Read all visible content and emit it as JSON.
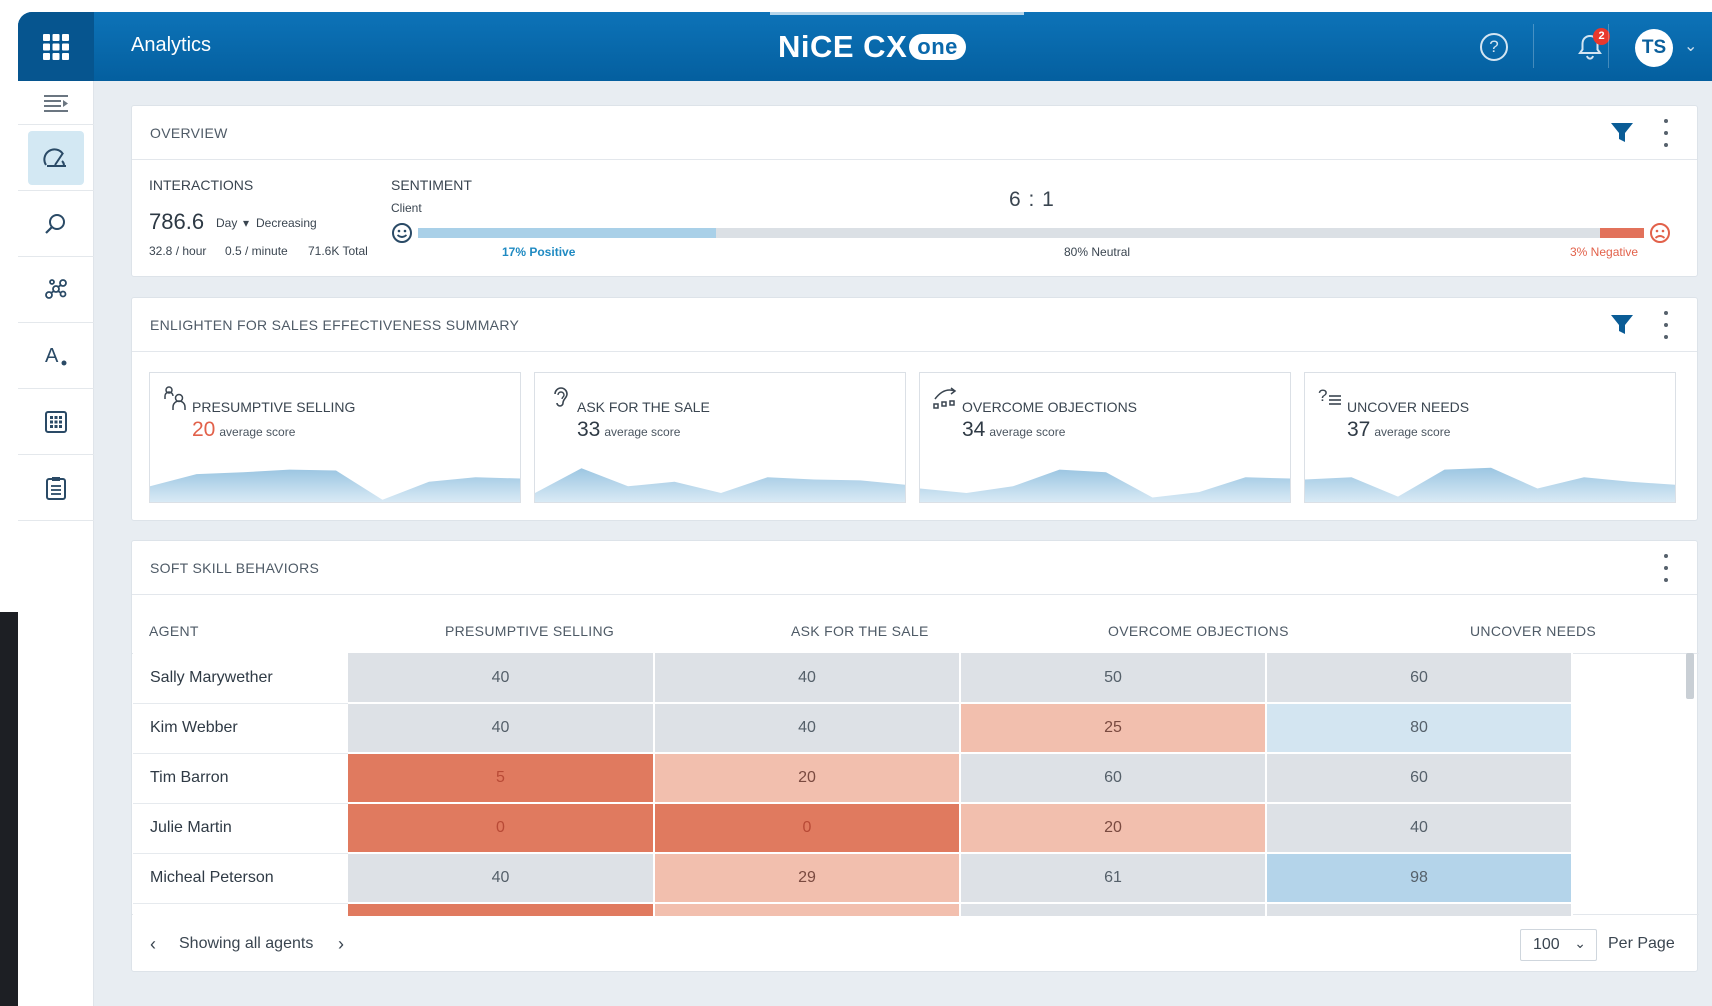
{
  "header": {
    "app_title": "Analytics",
    "brand_text": "NiCE CX",
    "brand_pill": "one",
    "notifications_count": "2",
    "avatar_initials": "TS",
    "accent_color": "#0a68ab"
  },
  "sidebar": {
    "items": [
      {
        "icon": "collapse-menu-icon"
      },
      {
        "icon": "dashboard-gauge-icon",
        "active": true
      },
      {
        "icon": "search-icon"
      },
      {
        "icon": "network-nodes-icon"
      },
      {
        "icon": "text-settings-icon"
      },
      {
        "icon": "calculator-grid-icon"
      },
      {
        "icon": "clipboard-list-icon"
      }
    ]
  },
  "overview": {
    "title": "OVERVIEW",
    "interactions_label": "INTERACTIONS",
    "interactions_value": "786.6",
    "period": "Day",
    "trend": "Decreasing",
    "per_hour": "32.8 / hour",
    "per_minute": "0.5 / minute",
    "total": "71.6K Total",
    "sentiment_label": "SENTIMENT",
    "sentiment_sub": "Client",
    "ratio": "6 : 1",
    "positive_label": "17% Positive",
    "neutral_label": "80% Neutral",
    "negative_label": "3% Negative",
    "positive_pct": 17,
    "neutral_pct": 80,
    "negative_pct": 3,
    "positive_color": "#a9d0e8",
    "negative_color": "#e2725b"
  },
  "summary": {
    "title": "ENLIGHTEN FOR SALES EFFECTIVENESS SUMMARY",
    "score_suffix": "average score",
    "cards": [
      {
        "title": "PRESUMPTIVE SELLING",
        "score": "20",
        "icon": "presumptive-selling-icon",
        "spark": [
          0.35,
          0.62,
          0.66,
          0.72,
          0.7,
          0.05,
          0.45,
          0.55,
          0.52
        ]
      },
      {
        "title": "ASK FOR THE SALE",
        "score": "33",
        "icon": "ear-icon",
        "spark": [
          0.2,
          0.75,
          0.35,
          0.45,
          0.2,
          0.55,
          0.5,
          0.48,
          0.38
        ]
      },
      {
        "title": "OVERCOME OBJECTIONS",
        "score": "34",
        "icon": "objections-arrow-icon",
        "spark": [
          0.3,
          0.2,
          0.35,
          0.72,
          0.66,
          0.1,
          0.22,
          0.55,
          0.52
        ]
      },
      {
        "title": "UNCOVER NEEDS",
        "score": "37",
        "icon": "question-list-icon",
        "spark": [
          0.5,
          0.55,
          0.12,
          0.72,
          0.76,
          0.3,
          0.55,
          0.45,
          0.38
        ]
      }
    ]
  },
  "soft_skills": {
    "title": "SOFT SKILL BEHAVIORS",
    "columns": [
      "AGENT",
      "PRESUMPTIVE SELLING",
      "ASK FOR THE SALE",
      "OVERCOME OBJECTIONS",
      "UNCOVER NEEDS"
    ],
    "rows": [
      {
        "agent": "Sally Marywether",
        "values": [
          "40",
          "40",
          "50",
          "60"
        ]
      },
      {
        "agent": "Kim Webber",
        "values": [
          "40",
          "40",
          "25",
          "80"
        ]
      },
      {
        "agent": "Tim Barron",
        "values": [
          "5",
          "20",
          "60",
          "60"
        ]
      },
      {
        "agent": "Julie Martin",
        "values": [
          "0",
          "0",
          "20",
          "40"
        ]
      },
      {
        "agent": "Micheal Peterson",
        "values": [
          "40",
          "29",
          "61",
          "98"
        ]
      }
    ],
    "footer_text": "Showing all agents",
    "per_page_value": "100",
    "per_page_label": "Per Page"
  }
}
